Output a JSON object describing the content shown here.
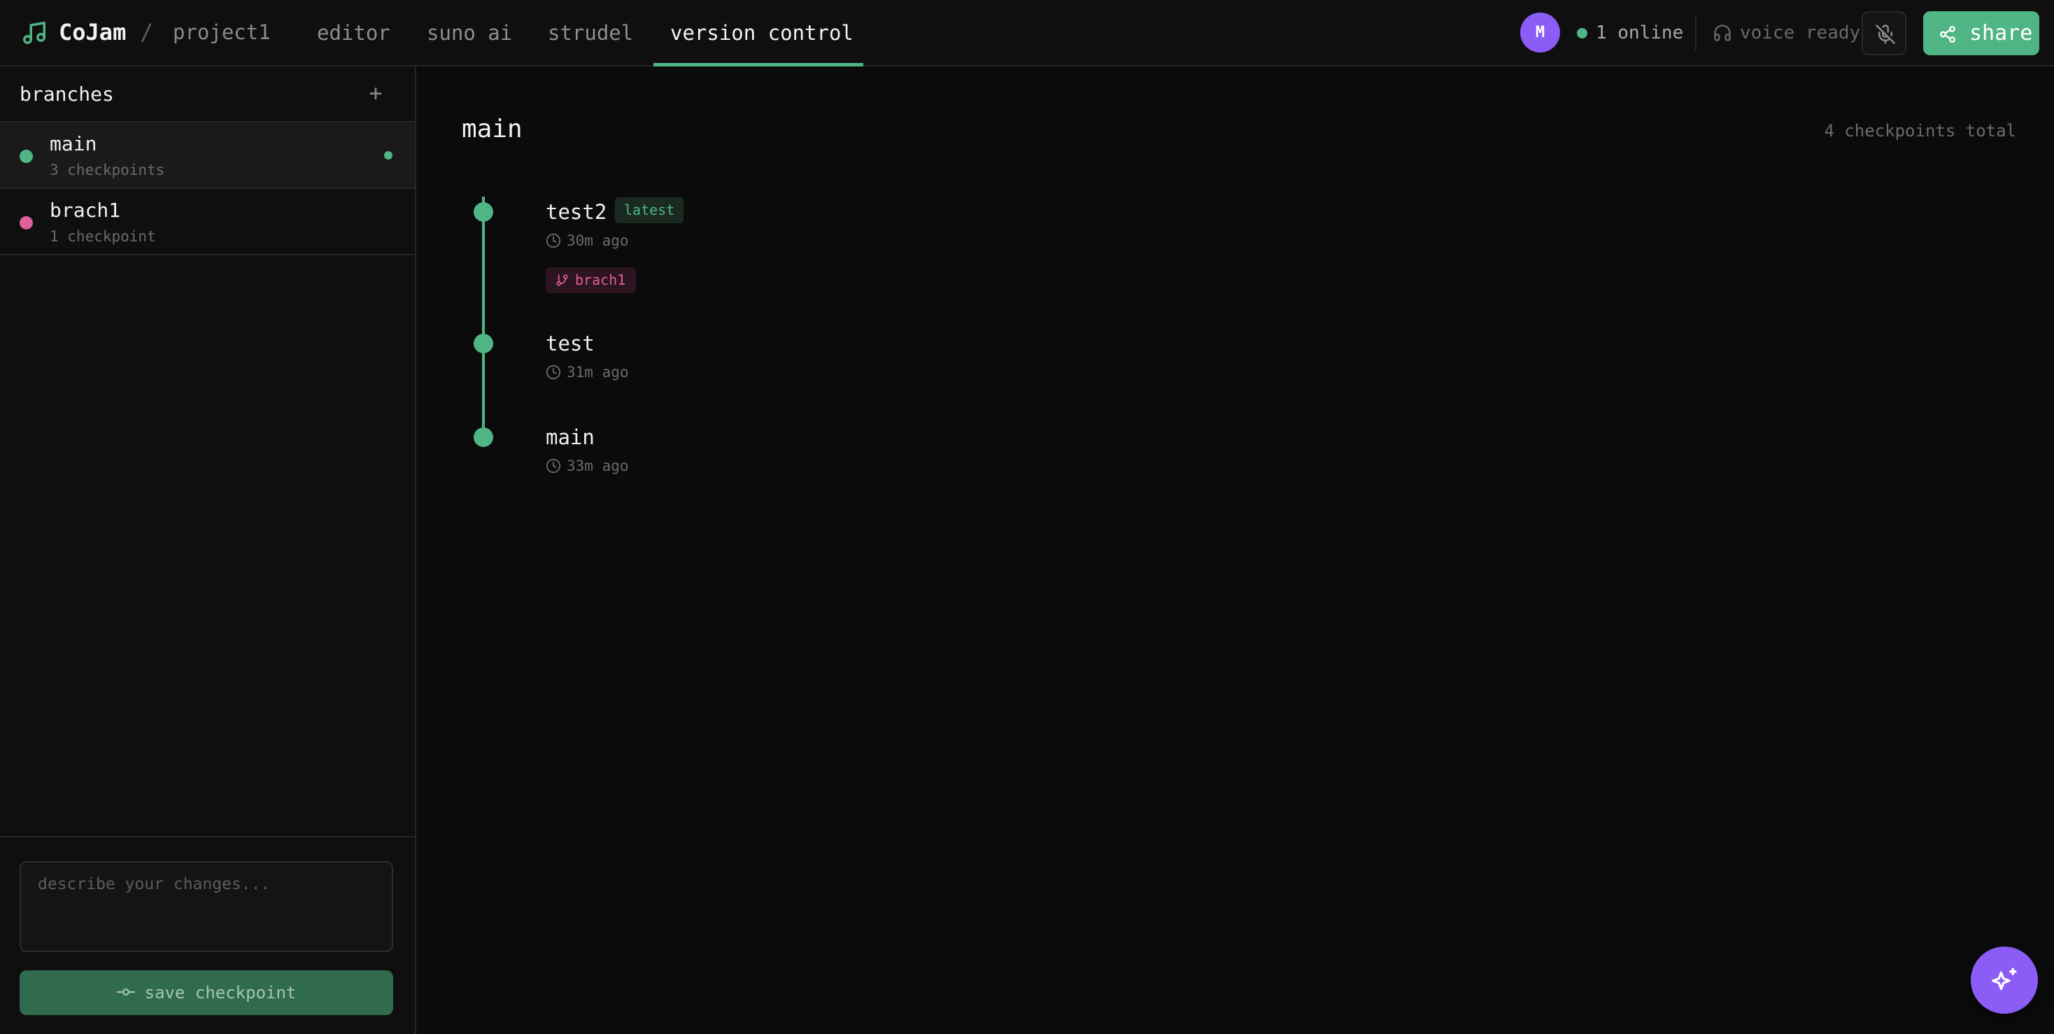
{
  "app": {
    "name": "CoJam",
    "breadcrumb_separator": "/",
    "project": "project1"
  },
  "tabs": [
    {
      "label": "editor",
      "active": false
    },
    {
      "label": "suno ai",
      "active": false
    },
    {
      "label": "strudel",
      "active": false
    },
    {
      "label": "version control",
      "active": true
    }
  ],
  "header": {
    "avatar_initial": "M",
    "online_text": "1 online",
    "voice_text": "voice ready",
    "share_label": "share"
  },
  "sidebar": {
    "title": "branches",
    "add_label": "+",
    "branches": [
      {
        "name": "main",
        "count_text": "3 checkpoints",
        "color": "#4fb584",
        "selected": true
      },
      {
        "name": "brach1",
        "count_text": "1 checkpoint",
        "color": "#e0609c",
        "selected": false
      }
    ],
    "input_placeholder": "describe your changes...",
    "save_label": "save checkpoint"
  },
  "main": {
    "branch_title": "main",
    "total_text": "4 checkpoints total",
    "checkpoints": [
      {
        "name": "test2",
        "time": "30m ago",
        "badge": "latest",
        "branch_tag": "brach1"
      },
      {
        "name": "test",
        "time": "31m ago"
      },
      {
        "name": "main",
        "time": "33m ago"
      }
    ]
  },
  "colors": {
    "accent": "#4fb584",
    "branch_pink": "#e0609c",
    "purple": "#8b5cf6",
    "background": "#0b0b0b"
  },
  "icons": [
    "music-note-icon",
    "headphones-icon",
    "mic-off-icon",
    "share-icon",
    "commit-icon",
    "clock-icon",
    "git-branch-icon",
    "sparkles-icon"
  ]
}
